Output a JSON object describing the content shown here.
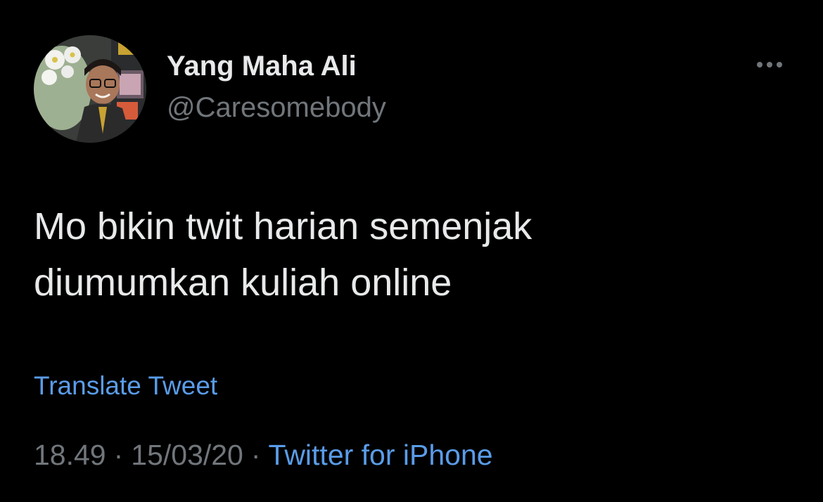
{
  "user": {
    "display_name": "Yang Maha Ali",
    "handle": "@Caresomebody",
    "avatar_icon": "profile-photo"
  },
  "tweet": {
    "text_lines": [
      "Mo bikin twit harian semenjak",
      "diumumkan kuliah online"
    ],
    "translate_label": "Translate Tweet",
    "time": "18.49",
    "separator": "·",
    "date": "15/03/20",
    "source": "Twitter for iPhone"
  },
  "icons": {
    "more": "more-horizontal-icon"
  },
  "colors": {
    "background": "#000000",
    "primary_text": "#e7e9ea",
    "secondary_text": "#71767b",
    "link": "#5a9ce8"
  }
}
